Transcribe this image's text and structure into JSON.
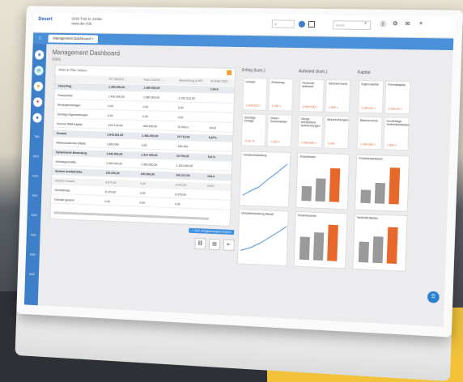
{
  "app": {
    "logo": "Desert",
    "project_name": "0293 Trek to Jordan",
    "project_sub": "www.dw-club",
    "search_placeholder": "Suche"
  },
  "tab": {
    "label": "Management Dashboard"
  },
  "page": {
    "title": "Management Dashboard",
    "subtitle": "RWA"
  },
  "sidebar": {
    "labels": [
      "T60",
      "B10",
      "G10",
      "S20",
      "E00",
      "S30",
      "E60",
      "B40"
    ]
  },
  "table": {
    "title": "RWA in Plan Values",
    "headers": [
      "",
      "IST 06/2022 ...",
      "Plan 12/2022 ...",
      "Abweichung (CHF)",
      "Ist Mitte 2022"
    ],
    "rows": [
      {
        "label": "Zinsertrag",
        "cells": [
          "1.490.000,00",
          "1.380.000,00",
          "",
          "1.04,4"
        ],
        "cls": "grp"
      },
      {
        "label": "Finanzmittel",
        "cells": [
          "1.490.000,00",
          "1.380.000,00",
          "1.152.213,00",
          ""
        ],
        "cls": ""
      },
      {
        "label": "Wertpapieranlagen",
        "cells": [
          "0,00",
          "0,00",
          "0,00",
          ""
        ],
        "cls": ""
      },
      {
        "label": "Sonstige Eigenleistungen",
        "cells": [
          "0,00",
          "0,00",
          "0,00",
          ""
        ],
        "cls": ""
      },
      {
        "label": "Summe RWA Kapital",
        "cells": [
          "-101.0.40,00",
          "-400.000,00",
          "10.000,0",
          "104,6"
        ],
        "cls": ""
      },
      {
        "label": "Gesamt",
        "cells": [
          "1.943.391,00",
          "1.481.000,00",
          "19.713,03",
          "0,87%"
        ],
        "cls": "grp"
      },
      {
        "label": "Risikomindernde Effekte",
        "cells": [
          "1.800.000",
          "0,00",
          "-180.000",
          ""
        ],
        "cls": ""
      },
      {
        "label": "Dynamische Bewertung",
        "cells": [
          "1.940.000,00",
          "1.517.000,00",
          "19.700,00",
          "0,8 %"
        ],
        "cls": "grp"
      },
      {
        "label": "Derivatgeschäfte",
        "cells": [
          "1.940.000,00",
          "1.360.000,00",
          "1.193.000,00",
          ""
        ],
        "cls": ""
      },
      {
        "label": "Summe Ausfallrisiko",
        "cells": [
          "100.200,00",
          "190.000,00",
          "100.227,00",
          "104,4"
        ],
        "cls": "grp"
      },
      {
        "label": "Summe Gesamt",
        "cells": [
          "8.370,00",
          "0,00",
          "8.370,00",
          "100%"
        ],
        "cls": "hdr"
      },
      {
        "label": "Derivatfonds",
        "cells": [
          "8.370,00",
          "0,00",
          "8.370,00",
          ""
        ],
        "cls": ""
      },
      {
        "label": "Derivate gesamt",
        "cells": [
          "0,00",
          "0,00",
          "0,00",
          ""
        ],
        "cls": ""
      }
    ],
    "add_button": "+ Zum erfolgsbezogene Export"
  },
  "sections": {
    "left": "Erfolg (kum.)",
    "mid": "Aufwand (kum.)",
    "right": "Kapital"
  },
  "kpis": {
    "left": [
      [
        "Umsatz",
        "1.934.623 ×"
      ],
      [
        "Rohertrag",
        "1.250 ×"
      ],
      [
        "Sonstige Erträge",
        "-0,10 %"
      ],
      [
        "Zinsen Gewinnanteil",
        "1.200 ×"
      ]
    ],
    "mid": [
      [
        "Personal-aufwand",
        "1.900.000 ×"
      ],
      [
        "Sachauf-wand",
        "1.930 ×"
      ],
      [
        "Übrige betriebliche Aufwendungen",
        "1.950.000 ×"
      ],
      [
        "Abschreibungen",
        "1.936"
      ]
    ],
    "right": [
      [
        "Eigen-kapital",
        "1.300,00 ×"
      ],
      [
        "Fremdkapital",
        "1.930,00 ×"
      ],
      [
        "Bilanzsumme",
        "1.940.000 ×"
      ],
      [
        "Kurzfristige Verbindlichkeiten",
        "1.800 ×"
      ]
    ]
  },
  "charts": {
    "line1_title": "Umsatzentwicklung",
    "line2_title": "Umsatzentwicklung Aktuell",
    "bar_titles": [
      "Zinsaufwand",
      "Provisionsaufwand",
      "Gesamtsumme",
      "Verbindlichkeiten"
    ]
  },
  "chart_data": [
    {
      "type": "bar",
      "title": "Zinsaufwand",
      "categories": [
        "1",
        "2",
        "3"
      ],
      "values": [
        40,
        60,
        90
      ]
    },
    {
      "type": "bar",
      "title": "Provisionsaufwand",
      "categories": [
        "1",
        "2",
        "3"
      ],
      "values": [
        35,
        55,
        95
      ]
    },
    {
      "type": "bar",
      "title": "Gesamtsumme",
      "categories": [
        "1",
        "2",
        "3"
      ],
      "values": [
        60,
        75,
        95
      ]
    },
    {
      "type": "bar",
      "title": "Verbindlichkeiten",
      "categories": [
        "1",
        "2",
        "3"
      ],
      "values": [
        55,
        70,
        95
      ]
    }
  ],
  "colors": {
    "accent": "#3d7fc8",
    "bar_gray": "#9a9a9a",
    "bar_orange": "#e8682c",
    "line": "#4a90d9"
  }
}
